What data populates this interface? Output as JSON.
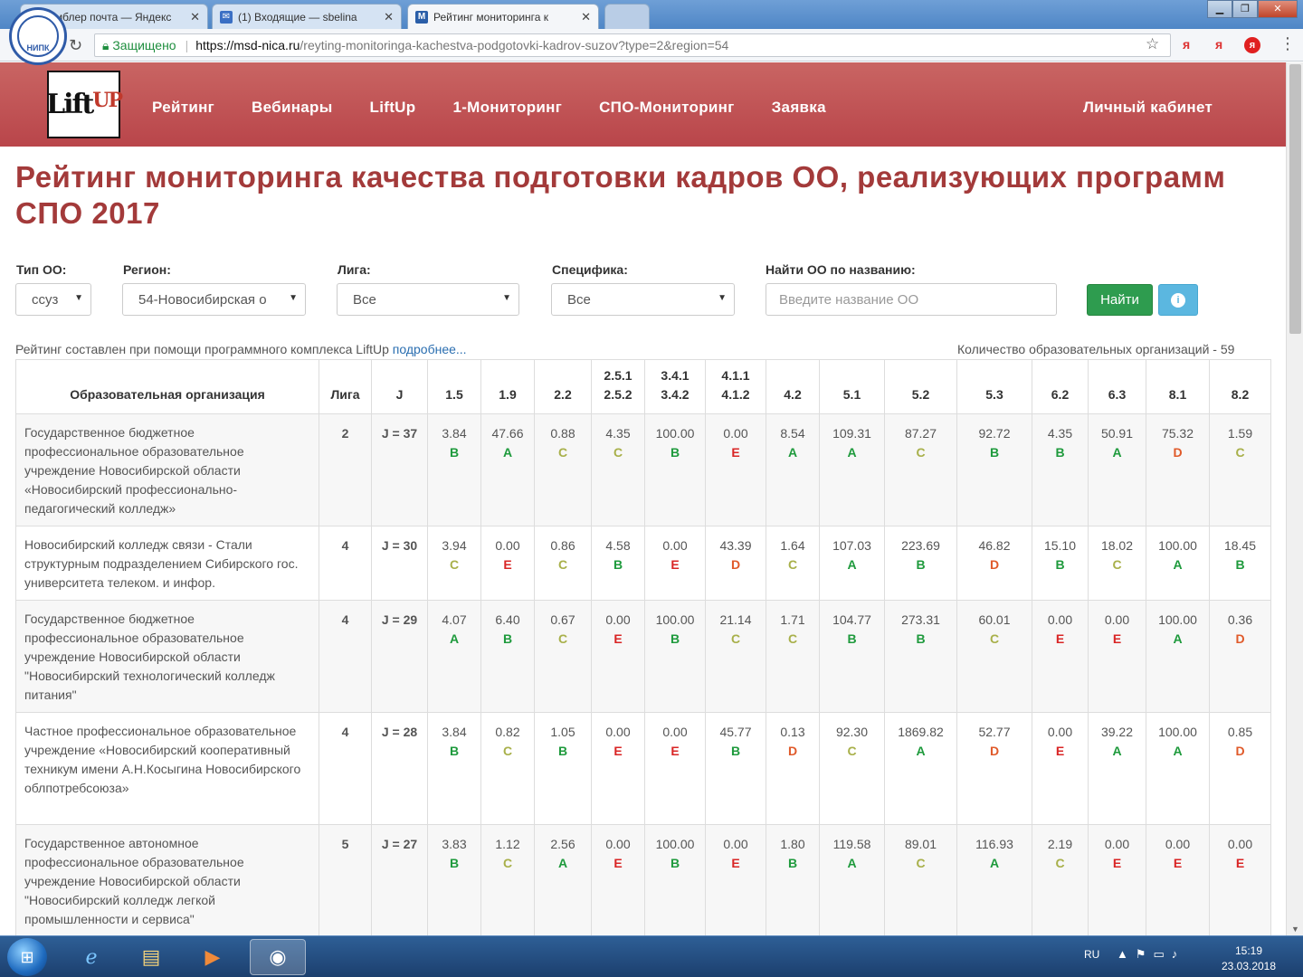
{
  "browser": {
    "tabs": [
      {
        "title": "...мблер почта — Яндекс",
        "icon": "mail-icon"
      },
      {
        "title": "(1) Входящие — sbelina",
        "icon": "mail-icon"
      },
      {
        "title": "Рейтинг мониторинга к",
        "icon": "m-site-icon"
      }
    ],
    "secure_label": "Защищено",
    "url_host": "https://msd-nica.ru",
    "url_path": "/reyting-monitoringa-kachestva-podgotovki-kadrov-suzov?type=2&region=54",
    "badge_text": "НИПК"
  },
  "site": {
    "logo_text": "Lift",
    "logo_up": "UP",
    "nav": [
      "Рейтинг",
      "Вебинары",
      "LiftUp",
      "1-Мониторинг",
      "СПО-Мониторинг",
      "Заявка"
    ],
    "cabinet": "Личный кабинет"
  },
  "page": {
    "title": "Рейтинг мониторинга качества подготовки кадров ОО, реализующих программ СПО 2017",
    "filters": {
      "type_label": "Тип ОО:",
      "type_value": "ссуз",
      "region_label": "Регион:",
      "region_value": "54-Новосибирская о",
      "league_label": "Лига:",
      "league_value": "Все",
      "spec_label": "Специфика:",
      "spec_value": "Все",
      "search_label": "Найти ОО по названию:",
      "search_placeholder": "Введите название ОО",
      "find_button": "Найти"
    },
    "note": "Рейтинг составлен при помощи программного комплекса LiftUp",
    "note_link": "подробнее...",
    "count": "Количество образовательных организаций - 59"
  },
  "table": {
    "headers": [
      {
        "l1": "",
        "l2": "Образовательная организация"
      },
      {
        "l1": "",
        "l2": "Лига"
      },
      {
        "l1": "",
        "l2": "J"
      },
      {
        "l1": "",
        "l2": "1.5"
      },
      {
        "l1": "",
        "l2": "1.9"
      },
      {
        "l1": "",
        "l2": "2.2"
      },
      {
        "l1": "2.5.1",
        "l2": "2.5.2"
      },
      {
        "l1": "3.4.1",
        "l2": "3.4.2"
      },
      {
        "l1": "4.1.1",
        "l2": "4.1.2"
      },
      {
        "l1": "",
        "l2": "4.2"
      },
      {
        "l1": "",
        "l2": "5.1"
      },
      {
        "l1": "",
        "l2": "5.2"
      },
      {
        "l1": "",
        "l2": "5.3"
      },
      {
        "l1": "",
        "l2": "6.2"
      },
      {
        "l1": "",
        "l2": "6.3"
      },
      {
        "l1": "",
        "l2": "8.1"
      },
      {
        "l1": "",
        "l2": "8.2"
      }
    ],
    "rows": [
      {
        "org": "Государственное бюджетное профессиональное образовательное учреждение Новосибирской области «Новосибирский профессионально-педагогический колледж»",
        "liga": "2",
        "j": "J = 37",
        "cells": [
          [
            "3.84",
            "B"
          ],
          [
            "47.66",
            "A"
          ],
          [
            "0.88",
            "C"
          ],
          [
            "4.35",
            "C"
          ],
          [
            "100.00",
            "B"
          ],
          [
            "0.00",
            "E"
          ],
          [
            "8.54",
            "A"
          ],
          [
            "109.31",
            "A"
          ],
          [
            "87.27",
            "C"
          ],
          [
            "92.72",
            "B"
          ],
          [
            "4.35",
            "B"
          ],
          [
            "50.91",
            "A"
          ],
          [
            "75.32",
            "D"
          ],
          [
            "1.59",
            "C"
          ]
        ]
      },
      {
        "org": "Новосибирский колледж связи - Стали структурным подразделением Сибирского гос. университета телеком. и инфор.",
        "liga": "4",
        "j": "J = 30",
        "cells": [
          [
            "3.94",
            "C"
          ],
          [
            "0.00",
            "E"
          ],
          [
            "0.86",
            "C"
          ],
          [
            "4.58",
            "B"
          ],
          [
            "0.00",
            "E"
          ],
          [
            "43.39",
            "D"
          ],
          [
            "1.64",
            "C"
          ],
          [
            "107.03",
            "A"
          ],
          [
            "223.69",
            "B"
          ],
          [
            "46.82",
            "D"
          ],
          [
            "15.10",
            "B"
          ],
          [
            "18.02",
            "C"
          ],
          [
            "100.00",
            "A"
          ],
          [
            "18.45",
            "B"
          ]
        ]
      },
      {
        "org": "Государственное бюджетное профессиональное образовательное учреждение Новосибирской области \"Новосибирский технологический колледж питания\"",
        "liga": "4",
        "j": "J = 29",
        "cells": [
          [
            "4.07",
            "A"
          ],
          [
            "6.40",
            "B"
          ],
          [
            "0.67",
            "C"
          ],
          [
            "0.00",
            "E"
          ],
          [
            "100.00",
            "B"
          ],
          [
            "21.14",
            "C"
          ],
          [
            "1.71",
            "C"
          ],
          [
            "104.77",
            "B"
          ],
          [
            "273.31",
            "B"
          ],
          [
            "60.01",
            "C"
          ],
          [
            "0.00",
            "E"
          ],
          [
            "0.00",
            "E"
          ],
          [
            "100.00",
            "A"
          ],
          [
            "0.36",
            "D"
          ]
        ]
      },
      {
        "org": "Частное профессиональное образовательное учреждение «Новосибирский кооперативный техникум имени А.Н.Косыгина Новосибирского облпотребсоюза»",
        "liga": "4",
        "j": "J = 28",
        "cells": [
          [
            "3.84",
            "B"
          ],
          [
            "0.82",
            "C"
          ],
          [
            "1.05",
            "B"
          ],
          [
            "0.00",
            "E"
          ],
          [
            "0.00",
            "E"
          ],
          [
            "45.77",
            "B"
          ],
          [
            "0.13",
            "D"
          ],
          [
            "92.30",
            "C"
          ],
          [
            "1869.82",
            "A"
          ],
          [
            "52.77",
            "D"
          ],
          [
            "0.00",
            "E"
          ],
          [
            "39.22",
            "A"
          ],
          [
            "100.00",
            "A"
          ],
          [
            "0.85",
            "D"
          ]
        ]
      },
      {
        "org": "Государственное автономное профессиональное образовательное учреждение Новосибирской области \"Новосибирский колледж легкой промышленности и сервиса\"",
        "liga": "5",
        "j": "J = 27",
        "cells": [
          [
            "3.83",
            "B"
          ],
          [
            "1.12",
            "C"
          ],
          [
            "2.56",
            "A"
          ],
          [
            "0.00",
            "E"
          ],
          [
            "100.00",
            "B"
          ],
          [
            "0.00",
            "E"
          ],
          [
            "1.80",
            "B"
          ],
          [
            "119.58",
            "A"
          ],
          [
            "89.01",
            "C"
          ],
          [
            "116.93",
            "A"
          ],
          [
            "2.19",
            "C"
          ],
          [
            "0.00",
            "E"
          ],
          [
            "0.00",
            "E"
          ],
          [
            "0.00",
            "E"
          ]
        ]
      }
    ]
  },
  "taskbar": {
    "lang": "RU",
    "time": "15:19",
    "date": "23.03.2018"
  }
}
